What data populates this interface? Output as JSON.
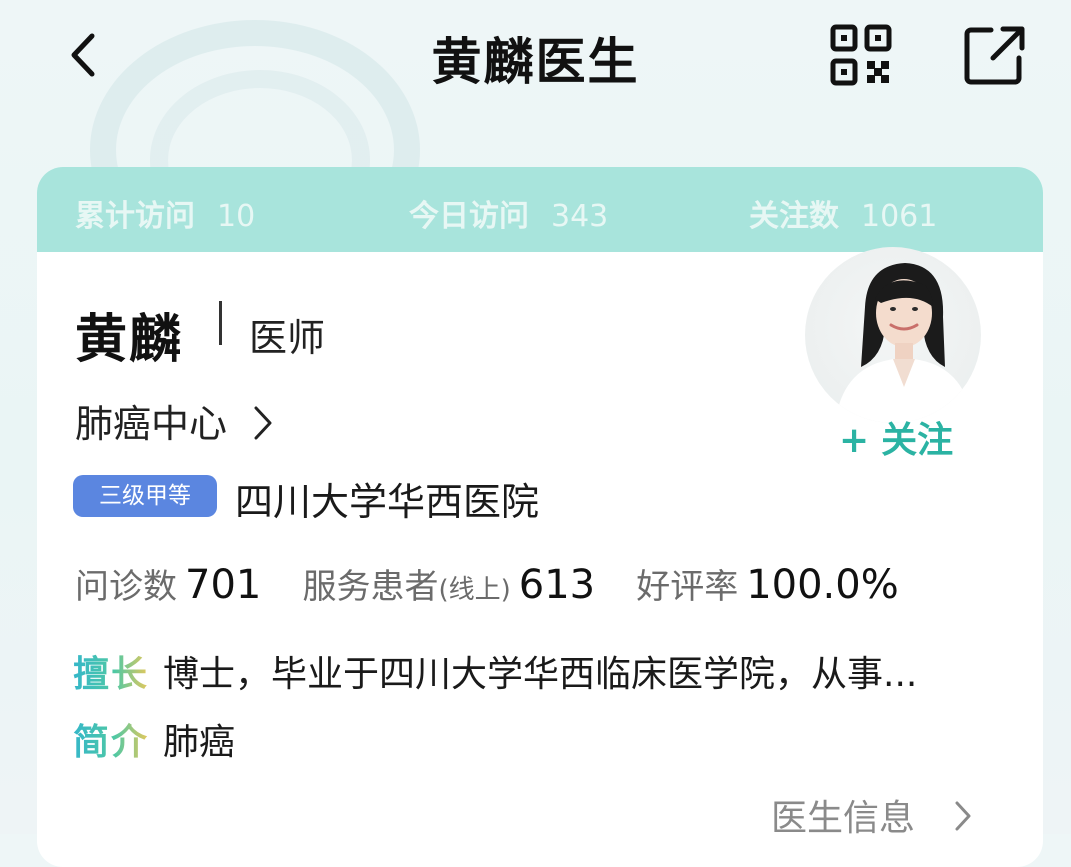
{
  "nav": {
    "title": "黄麟医生",
    "icons": {
      "back": "chevron-left-icon",
      "qr": "qr-code-icon",
      "share": "share-external-icon"
    }
  },
  "stats": {
    "total_visits_label": "累计访问",
    "total_visits_value": "10",
    "today_visits_label": "今日访问",
    "today_visits_value": "343",
    "followers_label": "关注数",
    "followers_value": "1061"
  },
  "doctor": {
    "name": "黄麟",
    "title": "医师",
    "department": "肺癌中心",
    "hospital_level_badge": "三级甲等",
    "hospital": "四川大学华西医院",
    "follow_label": "关注"
  },
  "metrics": {
    "consultations_label": "问诊数",
    "consultations_value": "701",
    "patients_label": "服务患者",
    "patients_sub": "(线上)",
    "patients_value": "613",
    "rating_label": "好评率",
    "rating_value": "100.0%"
  },
  "profile": {
    "expertise_tag": "擅长",
    "expertise_text": "博士，毕业于四川大学华西临床医学院，从事...",
    "intro_tag": "简介",
    "intro_text": "肺癌"
  },
  "footer": {
    "doctor_info_link": "医生信息"
  },
  "colors": {
    "stats_bar": "#a8e4dc",
    "accent": "#2bb3a3",
    "badge": "#5b86e0"
  }
}
